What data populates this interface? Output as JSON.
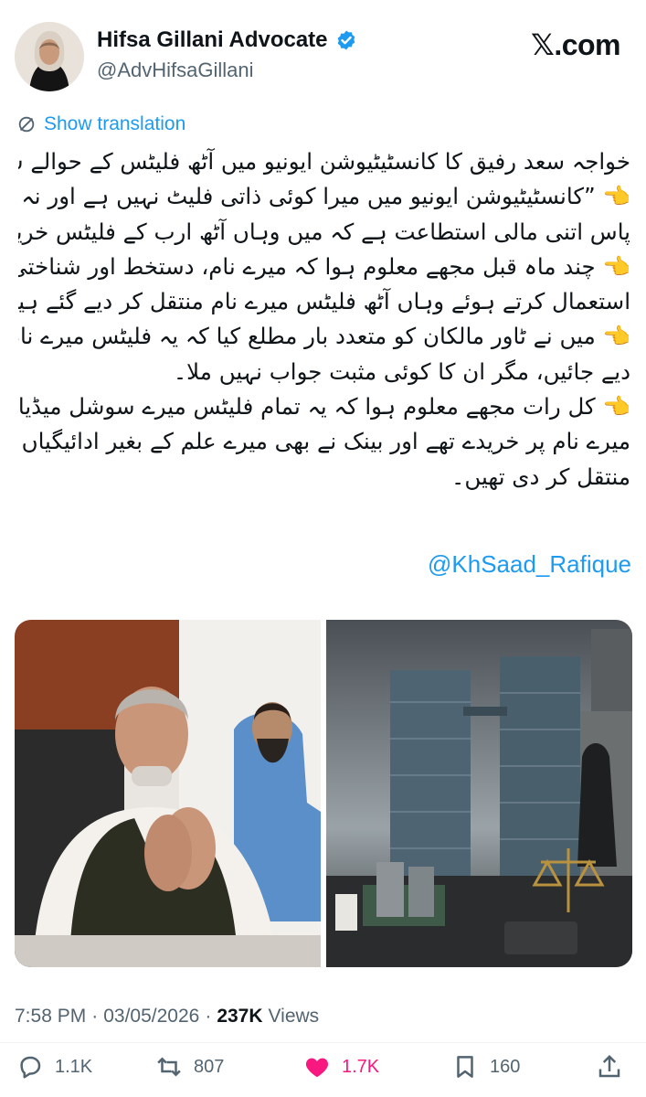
{
  "header": {
    "display_name": "Hifsa Gillani Advocate",
    "handle": "@AdvHifsaGillani",
    "brand": "𝕏.com",
    "verified_color": "#1d9bf0"
  },
  "translation": {
    "label": "Show translation"
  },
  "tweet": {
    "lines": [
      "خواجہ سعد رفیق کا کانسٹیٹیوشن ایونیو میں آٹھ فلیٹس کے حوالے سے اہم بیان",
      "👈 ”کانسٹیٹیوشن ایونیو میں میرا کوئی ذاتی فلیٹ نہیں ہے اور نہ ہی میرے",
      "پاس اتنی مالی استطاعت ہے کہ میں وہاں آٹھ ارب کے فلیٹس خرید سکوں۔",
      "👈 چند ماہ قبل مجھے معلوم ہوا کہ میرے نام، دستخط اور شناختی کارڈ کا",
      "استعمال کرتے ہوئے وہاں آٹھ فلیٹس میرے نام منتقل کر دیے گئے ہیں۔",
      "👈 میں نے ٹاور مالکان کو متعدد بار مطلع کیا کہ یہ فلیٹس میرے نام سے ہٹا",
      "دیے جائیں، مگر ان کا کوئی مثبت جواب نہیں ملا۔",
      "👈 کل رات مجھے معلوم ہوا کہ یہ تمام فلیٹس میرے سوشل میڈیا مینیجر نے",
      "میرے نام پر خریدے تھے اور بینک نے بھی میرے علم کے بغیر ادائیگیاں",
      "منتقل کر دی تھیں۔"
    ],
    "mention": "@KhSaad_Rafique"
  },
  "meta": {
    "time": "7:58 PM",
    "sep1": "·",
    "date": "03/05/2026",
    "sep2": "·",
    "views_count": "237K",
    "views_label": "Views"
  },
  "actions": {
    "replies": "1.1K",
    "reposts": "807",
    "likes": "1.7K",
    "bookmarks": "160",
    "like_color": "#f91880",
    "icons": [
      "reply-icon",
      "repost-icon",
      "heart-icon",
      "bookmark-icon",
      "share-icon"
    ]
  }
}
